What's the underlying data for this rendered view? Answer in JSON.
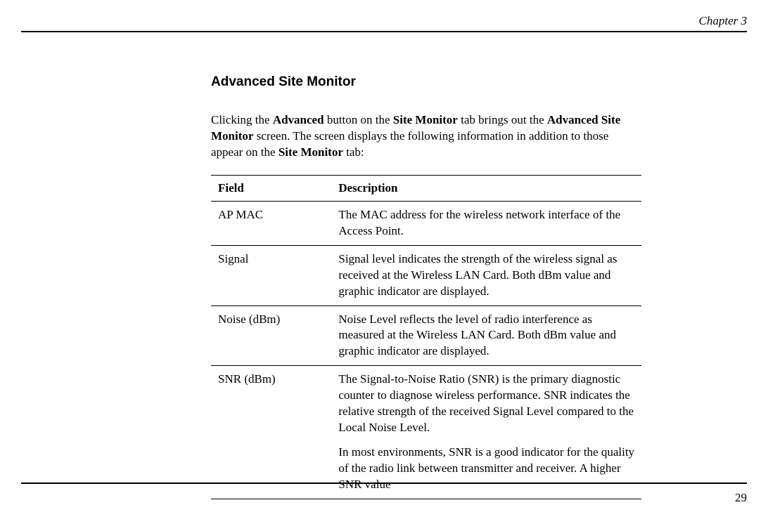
{
  "header": {
    "chapter": "Chapter 3"
  },
  "section": {
    "title": "Advanced Site Monitor"
  },
  "intro": {
    "part1": "Clicking the ",
    "bold1": "Advanced",
    "part2": " button on the ",
    "bold2": "Site Monitor",
    "part3": " tab brings out the ",
    "bold3": "Advanced Site Monitor",
    "part4": " screen. The screen displays the following information in addition to those appear on the ",
    "bold4": "Site Monitor",
    "part5": " tab:"
  },
  "table": {
    "headers": {
      "field": "Field",
      "description": "Description"
    },
    "rows": [
      {
        "field": "AP MAC",
        "description": "The MAC address for the wireless network interface of the Access Point."
      },
      {
        "field": "Signal",
        "description": "Signal level indicates the strength of the wireless signal as received at the Wireless LAN Card. Both dBm value and graphic indicator are displayed."
      },
      {
        "field": "Noise (dBm)",
        "description": "Noise Level reflects the level of radio interference as measured at the Wireless LAN Card. Both dBm value and graphic indicator are displayed."
      },
      {
        "field": "SNR (dBm)",
        "description_p1": "The Signal-to-Noise Ratio (SNR) is the primary diagnostic counter to diagnose wireless performance. SNR indicates the relative strength of the received Signal Level compared to the Local Noise Level.",
        "description_p2": "In most environments, SNR is a good indicator for the quality of the radio link between transmitter and receiver. A higher SNR value"
      }
    ]
  },
  "footer": {
    "pageNumber": "29"
  }
}
